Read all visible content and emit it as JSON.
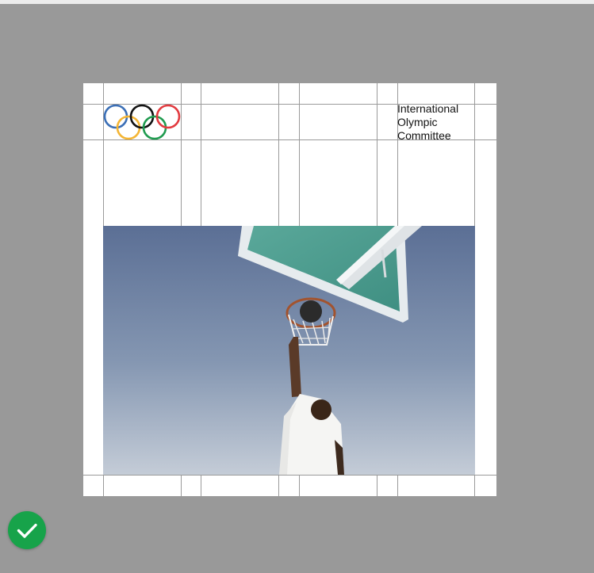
{
  "canvas": {
    "background": "#999999"
  },
  "artboard": {
    "background": "#ffffff",
    "logo": {
      "icon": "olympic-rings-icon",
      "ring_colors": [
        "#3b6fb6",
        "#f4b534",
        "#111111",
        "#1f9b4f",
        "#e23a3f"
      ]
    },
    "org_name_lines": [
      "International",
      "Olympic",
      "Committee"
    ],
    "photo": {
      "subject": "basketball-dunk-photo"
    },
    "grid_color": "#9a9a9a"
  },
  "confirm_button": {
    "icon": "checkmark-icon",
    "color": "#17a34a"
  }
}
